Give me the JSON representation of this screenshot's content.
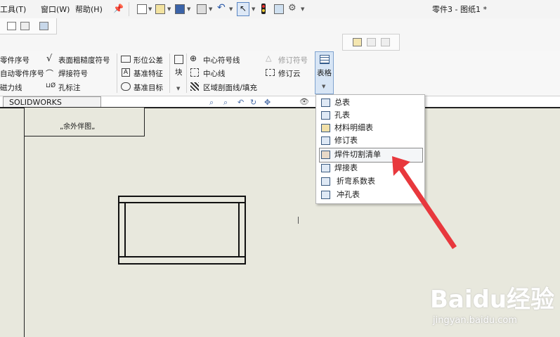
{
  "window": {
    "title": "零件3 - 图纸1 *"
  },
  "menu": {
    "tools": "工具(T)",
    "window": "窗口(W)",
    "help": "帮助(H)"
  },
  "ribbon": {
    "col1": [
      "零件序号",
      "自动零件序号",
      "磁力线"
    ],
    "col2": [
      "表面粗糙度符号",
      "焊接符号",
      "孔标注"
    ],
    "col3": [
      "形位公差",
      "基准特征",
      "基准目标"
    ],
    "block": "块",
    "col5": [
      "中心符号线",
      "中心线",
      "区域剖面线/填充"
    ],
    "col6": [
      "修订符号",
      "修订云"
    ],
    "table": "表格"
  },
  "tab": {
    "inspection": "SOLIDWORKS Inspection"
  },
  "drawing": {
    "title_text": "„余外伴图„"
  },
  "dropdown": {
    "items": [
      "总表",
      "孔表",
      "材料明细表",
      "修订表",
      "焊件切割清单",
      "焊接表",
      "折弯系数表",
      "冲孔表"
    ],
    "selected": "焊件切割清单"
  },
  "watermark": {
    "brand": "Baidu经验",
    "url": "jingyan.baidu.com"
  },
  "colors": {
    "arrow": "#e8383d",
    "canvas": "#e8e8dd"
  }
}
